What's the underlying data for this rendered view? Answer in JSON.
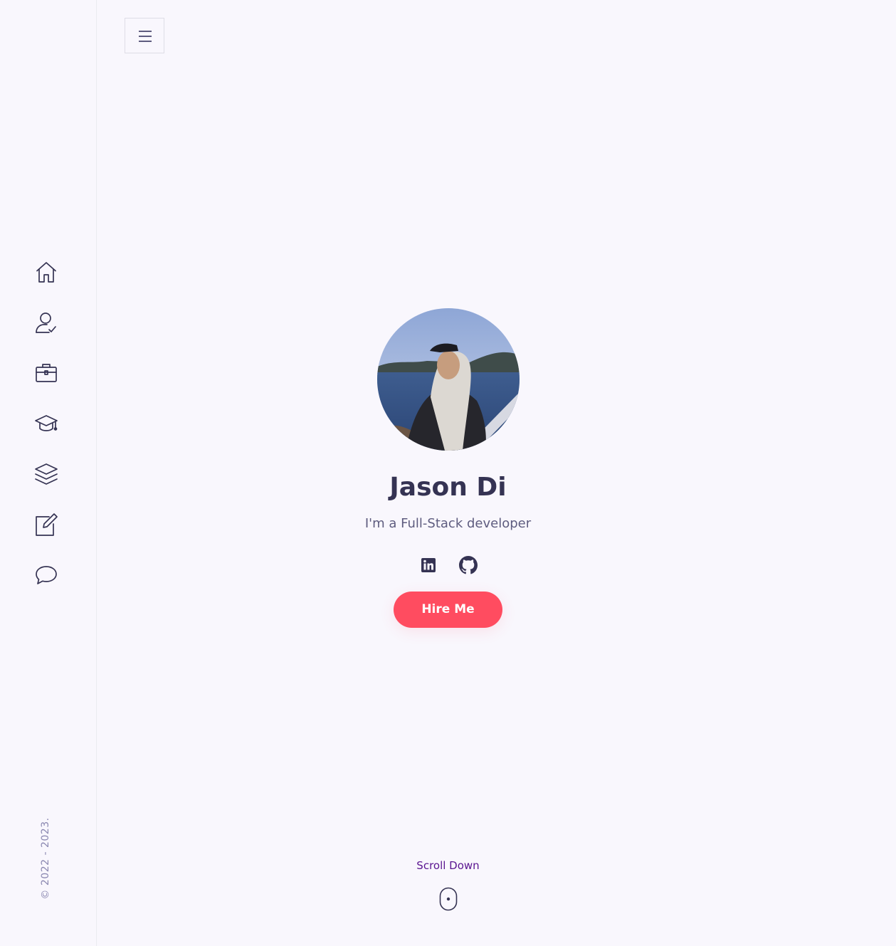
{
  "sidebar": {
    "nav": [
      {
        "icon": "home-icon",
        "label": "Home"
      },
      {
        "icon": "user-check-icon",
        "label": "About"
      },
      {
        "icon": "briefcase-icon",
        "label": "Services"
      },
      {
        "icon": "graduation-cap-icon",
        "label": "Experience"
      },
      {
        "icon": "layers-icon",
        "label": "Works"
      },
      {
        "icon": "edit-icon",
        "label": "Blog"
      },
      {
        "icon": "chat-bubble-icon",
        "label": "Contact"
      }
    ],
    "copyright": "© 2022 - 2023."
  },
  "header": {
    "menu_icon": "hamburger-icon"
  },
  "hero": {
    "name": "Jason Di",
    "subtitle": "I'm a Full-Stack developer",
    "socials": [
      {
        "icon": "linkedin-icon"
      },
      {
        "icon": "github-icon"
      }
    ],
    "cta_label": "Hire Me"
  },
  "scroll": {
    "label": "Scroll Down",
    "icon": "mouse-icon"
  },
  "colors": {
    "background": "#f9f7fd",
    "heading": "#353353",
    "text": "#5e5c7f",
    "accent": "#ff4c60",
    "scroll_label": "#5a1590",
    "muted": "#8b88b1"
  }
}
